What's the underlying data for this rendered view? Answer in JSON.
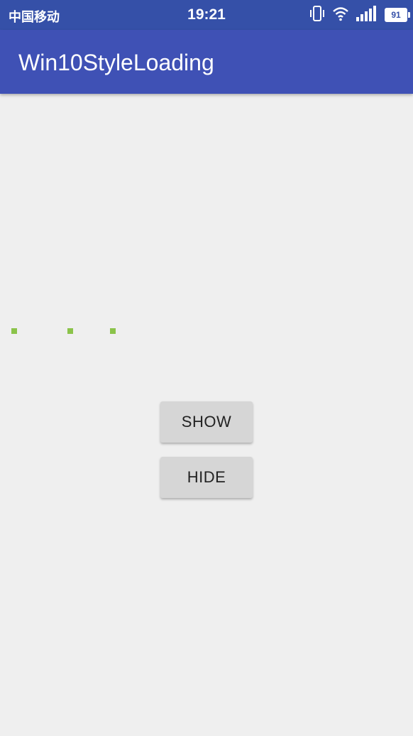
{
  "status_bar": {
    "carrier": "中国移动",
    "time": "19:21",
    "battery_level": "91",
    "icons": [
      "vibrate-icon",
      "wifi-icon",
      "signal-icon",
      "battery-icon"
    ]
  },
  "app_bar": {
    "title": "Win10StyleLoading",
    "color": "#3f51b5"
  },
  "loader": {
    "dot_color": "#8bc34a",
    "dot_count": 3
  },
  "buttons": {
    "show_label": "SHOW",
    "hide_label": "HIDE"
  },
  "colors": {
    "status_bar": "#3550a8",
    "background": "#efefef",
    "button": "#d6d6d6"
  }
}
